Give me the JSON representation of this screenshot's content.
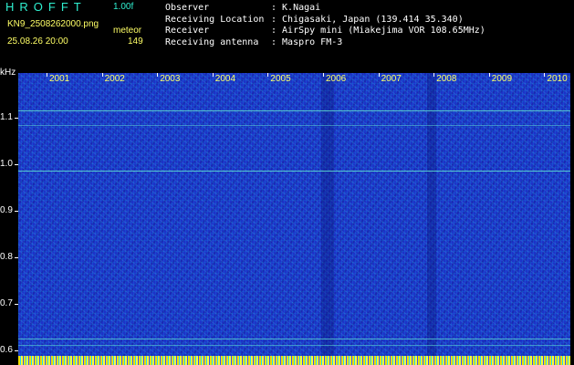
{
  "header": {
    "logo": "HROFFT",
    "version": "1.00f",
    "filename": "KN9_2508262000.png",
    "meteor_label": "meteor",
    "datetime": "25.08.26 20:00",
    "meteor_count": "149"
  },
  "meta": [
    {
      "key": "Observer",
      "value": ": K.Nagai"
    },
    {
      "key": "Receiving Location",
      "value": ": Chigasaki, Japan (139.414 35.340)"
    },
    {
      "key": "Receiver",
      "value": ": AirSpy mini (Miakejima VOR 108.65MHz)"
    },
    {
      "key": "Receiving antenna",
      "value": ": Maspro FM-3"
    }
  ],
  "spectrogram": {
    "unit": "kHz",
    "y_labels": [
      "1.1",
      "1.0",
      "0.9",
      "0.8",
      "0.7",
      "0.6"
    ],
    "x_labels": [
      "2001",
      "2002",
      "2003",
      "2004",
      "2005",
      "2006",
      "2007",
      "2008",
      "2009",
      "2010"
    ],
    "colors": {
      "background": "#1d33c8",
      "trace": "#5fe0d0",
      "axis_text": "#ffffff",
      "time_text": "#ffff66"
    }
  }
}
